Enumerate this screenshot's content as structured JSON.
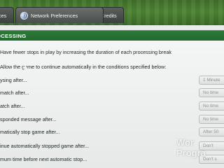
{
  "tabs": {
    "previous": "ces",
    "network": "Network Preferences",
    "credits": "Credits"
  },
  "section": {
    "title": "OCESSING"
  },
  "intro": {
    "fewer_stops": "Have fewer stops in play by increasing the duration of each processing break",
    "allow_continue": "Allow the game to continue automatically in the conditions specified below:"
  },
  "options": [
    {
      "label": "ysing after...",
      "value": "1 Minute"
    },
    {
      "label": "match after...",
      "value": "No time"
    },
    {
      "label": "atch after...",
      "value": "No time"
    },
    {
      "label": "sponded message after...",
      "value": "No time"
    },
    {
      "label": "matically stop game after...",
      "value": "After 50"
    },
    {
      "label": "inue automatically stopped game after...",
      "value": "Don't"
    },
    {
      "label": "mum time before next automatic stop...",
      "value": "Don't s"
    }
  ],
  "watermark": {
    "line1": "Wor",
    "line2": "Progra"
  }
}
